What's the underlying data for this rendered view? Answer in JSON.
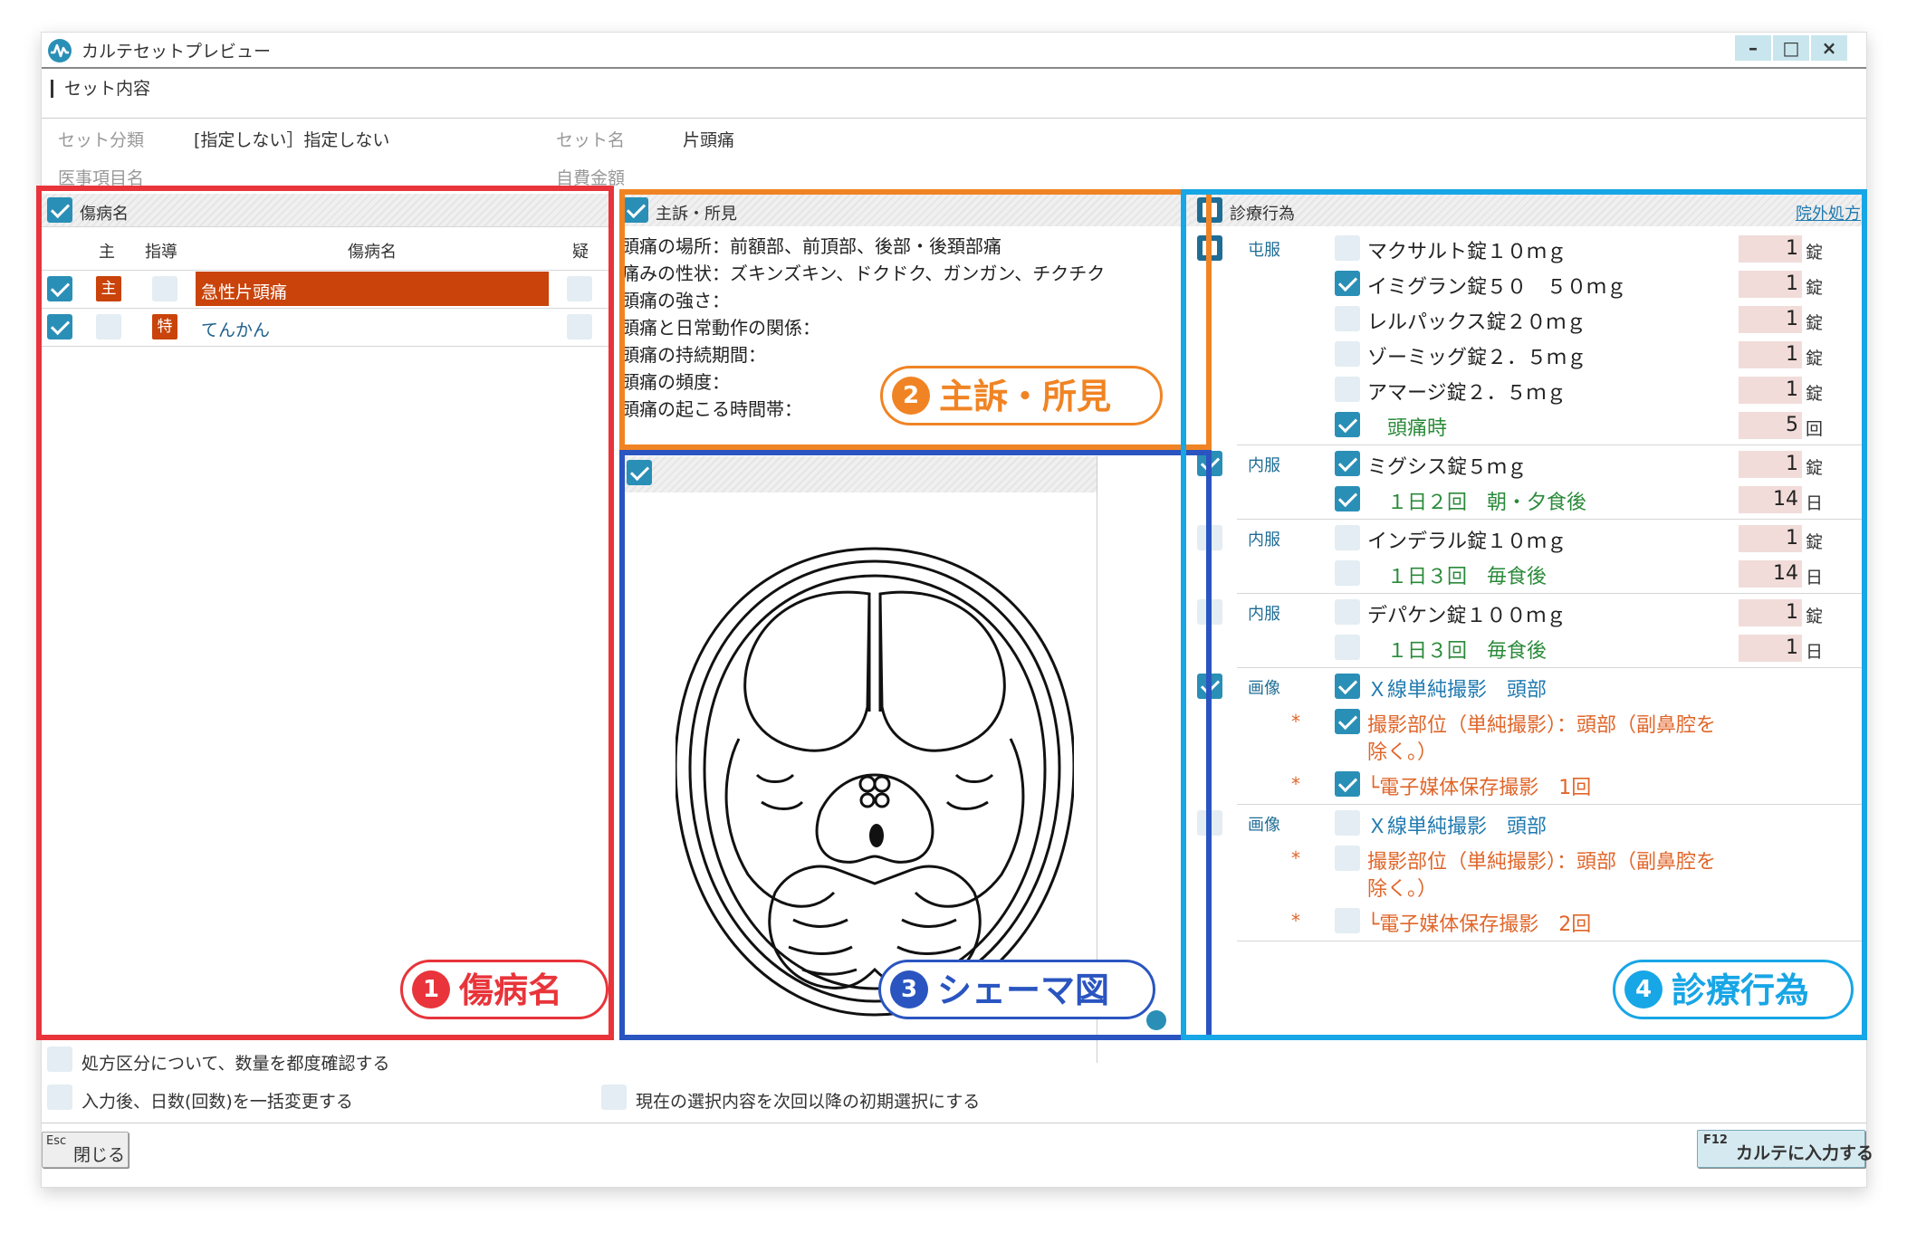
{
  "window": {
    "title": "カルテセットプレビュー",
    "controls": {
      "minimize": "–",
      "maximize": "□",
      "close": "×"
    }
  },
  "set_info": {
    "section_title": "セット内容",
    "set_category_label": "セット分類",
    "set_category_value": "[指定しない］指定しない",
    "set_name_label": "セット名",
    "set_name_value": "片頭痛",
    "medical_item_label": "医事項目名",
    "self_pay_label": "自費金額"
  },
  "diagnosis": {
    "header": "傷病名",
    "columns": {
      "main": "主",
      "guidance": "指導",
      "name": "傷病名",
      "suspected": "疑"
    },
    "rows": [
      {
        "checked": true,
        "main_badge": "主",
        "guidance_badge": "",
        "name": "急性片頭痛",
        "selected": true
      },
      {
        "checked": true,
        "main_badge": "",
        "guidance_badge": "特",
        "name": "てんかん",
        "selected": false
      }
    ]
  },
  "complaint": {
    "header": "主訴・所見",
    "lines": [
      "頭痛の場所：前額部、前頂部、後部・後頚部痛",
      "痛みの性状：ズキンズキン、ドクドク、ガンガン、チクチク",
      "頭痛の強さ：",
      "頭痛と日常動作の関係：",
      "頭痛の持続期間：",
      "頭痛の頻度：",
      "頭痛の起こる時間帯："
    ]
  },
  "treatment": {
    "header": "診療行為",
    "outside_rx_link": "院外処方",
    "groups": [
      {
        "category": "屯服",
        "checked": "partial",
        "items": [
          {
            "checked": false,
            "name": "マクサルト錠１０ｍｇ",
            "qty": "1",
            "unit": "錠",
            "color": "#222222"
          },
          {
            "checked": true,
            "name": "イミグラン錠５０　５０ｍｇ",
            "qty": "1",
            "unit": "錠",
            "color": "#222222"
          },
          {
            "checked": false,
            "name": "レルパックス錠２０ｍｇ",
            "qty": "1",
            "unit": "錠",
            "color": "#222222"
          },
          {
            "checked": false,
            "name": "ゾーミッグ錠２．５ｍｇ",
            "qty": "1",
            "unit": "錠",
            "color": "#222222"
          },
          {
            "checked": false,
            "name": "アマージ錠２．５ｍｇ",
            "qty": "1",
            "unit": "錠",
            "color": "#222222"
          },
          {
            "checked": true,
            "name": "　頭痛時",
            "qty": "5",
            "unit": "回",
            "color": "#2a8a3a"
          }
        ]
      },
      {
        "category": "内服",
        "checked": "on",
        "items": [
          {
            "checked": true,
            "name": "ミグシス錠５ｍｇ",
            "qty": "1",
            "unit": "錠",
            "color": "#222222"
          },
          {
            "checked": true,
            "name": "　１日２回　朝・夕食後",
            "qty": "14",
            "unit": "日",
            "color": "#2a8a3a"
          }
        ]
      },
      {
        "category": "内服",
        "checked": "off",
        "items": [
          {
            "checked": false,
            "name": "インデラル錠１０ｍｇ",
            "qty": "1",
            "unit": "錠",
            "color": "#222222"
          },
          {
            "checked": false,
            "name": "　１日３回　毎食後",
            "qty": "14",
            "unit": "日",
            "color": "#2a8a3a"
          }
        ]
      },
      {
        "category": "内服",
        "checked": "off",
        "items": [
          {
            "checked": false,
            "name": "デパケン錠１００ｍｇ",
            "qty": "1",
            "unit": "錠",
            "color": "#222222"
          },
          {
            "checked": false,
            "name": "　１日３回　毎食後",
            "qty": "1",
            "unit": "日",
            "color": "#2a8a3a"
          }
        ]
      },
      {
        "category": "画像",
        "checked": "on",
        "items": [
          {
            "checked": true,
            "name": "Ｘ線単純撮影　頭部",
            "color": "#1f7ab0"
          },
          {
            "checked": true,
            "star": "*",
            "name": "撮影部位（単純撮影）：頭部（副鼻腔を",
            "name2": "除く。）",
            "color": "#e0662a"
          },
          {
            "checked": true,
            "star": "*",
            "name": "└電子媒体保存撮影　1回",
            "color": "#e0662a"
          }
        ]
      },
      {
        "category": "画像",
        "checked": "off",
        "items": [
          {
            "checked": false,
            "name": "Ｘ線単純撮影　頭部",
            "color": "#1f7ab0"
          },
          {
            "checked": false,
            "star": "*",
            "name": "撮影部位（単純撮影）：頭部（副鼻腔を",
            "name2": "除く。）",
            "color": "#e0662a"
          },
          {
            "checked": false,
            "star": "*",
            "name": "└電子媒体保存撮影　2回",
            "color": "#e0662a"
          }
        ]
      }
    ]
  },
  "callouts": [
    {
      "num": "1",
      "text": "傷病名",
      "color": "#e8343a"
    },
    {
      "num": "2",
      "text": "主訴・所見",
      "color": "#f08424"
    },
    {
      "num": "3",
      "text": "シェーマ図",
      "color": "#2a55c0"
    },
    {
      "num": "4",
      "text": "診療行為",
      "color": "#17a6e6"
    }
  ],
  "footer": {
    "opt1": "処方区分について、数量を都度確認する",
    "opt2": "入力後、日数(回数)を一括変更する",
    "opt3": "現在の選択内容を次回以降の初期選択にする",
    "close_key": "Esc",
    "close_label": "閉じる",
    "submit_key": "F12",
    "submit_label": "カルテに入力する"
  }
}
